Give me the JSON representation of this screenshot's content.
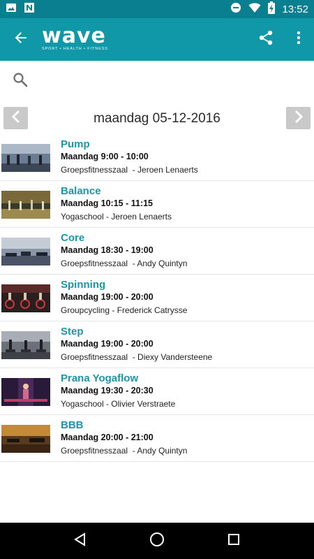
{
  "status_bar": {
    "time": "13:52",
    "icons": [
      "image-icon",
      "n-app-icon",
      "do-not-disturb-icon",
      "wifi-icon",
      "battery-charging-icon"
    ]
  },
  "app_bar": {
    "logo_text": "wave",
    "logo_tagline": "SPORT • HEALTH • FITNESS",
    "icons": [
      "back-arrow-icon",
      "share-icon",
      "more-vert-icon"
    ]
  },
  "search": {
    "icon": "search-icon"
  },
  "date_nav": {
    "title": "maandag 05-12-2016",
    "prev_icon": "chevron-left-icon",
    "next_icon": "chevron-right-icon"
  },
  "sessions": [
    {
      "title": "Pump",
      "time": "Maandag 9:00 - 10:00",
      "location": "Groepsfitnesszaal  - Jeroen Lenaerts"
    },
    {
      "title": "Balance",
      "time": "Maandag 10:15 - 11:15",
      "location": "Yogaschool - Jeroen Lenaerts"
    },
    {
      "title": "Core",
      "time": "Maandag 18:30 - 19:00",
      "location": "Groepsfitnesszaal  - Andy Quintyn"
    },
    {
      "title": "Spinning",
      "time": "Maandag 19:00 - 20:00",
      "location": "Groupcycling - Frederick Catrysse"
    },
    {
      "title": "Step",
      "time": "Maandag 19:00 - 20:00",
      "location": "Groepsfitnesszaal  - Diexy Vandersteene"
    },
    {
      "title": "Prana Yogaflow",
      "time": "Maandag 19:30 - 20:30",
      "location": "Yogaschool - Olivier Verstraete"
    },
    {
      "title": "BBB",
      "time": "Maandag 20:00 - 21:00",
      "location": "Groepsfitnesszaal  - Andy Quintyn"
    }
  ],
  "colors": {
    "status_bar": "#0a7f8f",
    "app_bar": "#1097a8",
    "title_accent": "#1a96a8",
    "nav_button": "#c9c9c9"
  },
  "system_nav": {
    "icons": [
      "back-triangle-icon",
      "home-circle-icon",
      "recents-square-icon"
    ]
  }
}
